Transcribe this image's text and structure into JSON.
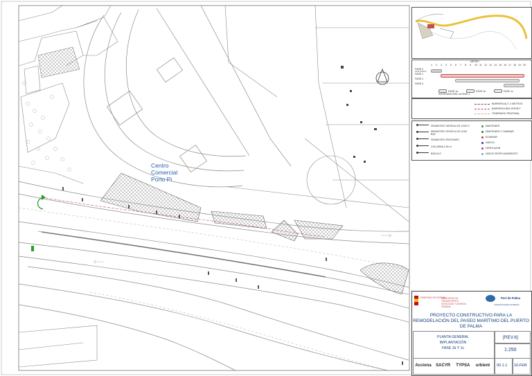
{
  "map": {
    "building_label": "Centro Comercial Porto Pi",
    "north_symbol": "N"
  },
  "timeline": {
    "header": "MESES",
    "months": [
      "1",
      "2",
      "3",
      "4",
      "5",
      "6",
      "7",
      "8",
      "9",
      "10",
      "11",
      "12",
      "13",
      "14",
      "15",
      "16",
      "17",
      "18",
      "19",
      "20"
    ],
    "phases": [
      {
        "label": "FASE 0",
        "sublabel": "FASE PREVIA"
      },
      {
        "label": "FASE 1",
        "sublabel": ""
      },
      {
        "label": "FASE 2",
        "sublabel": ""
      },
      {
        "label": "FASE 3",
        "sublabel": ""
      }
    ],
    "legend": [
      "FASE 1a",
      "FASE 1b",
      "FASE 1c"
    ],
    "legend_note": "INTERVENCIÓN 1a FASE 1"
  },
  "line_legend": {
    "items": [
      {
        "label": "BARRERA ALT. 2 METROS",
        "color": "#555555"
      },
      {
        "label": "BARRERA NEW JERSEY",
        "color": "#c0504d"
      },
      {
        "label": "ITINERARIO PEATONAL",
        "color": "#c9a0a0"
      }
    ]
  },
  "symbol_legend": {
    "left": [
      "SEMAFORO VEHÍCULOS 1/100 V",
      "SEMAFORO VEHÍCULOS 1/100 RAV",
      "SEMAFORO PEATONES",
      "COLUMNA 2.60 m",
      "BÁCULO"
    ],
    "right": [
      {
        "label": "MANTENER",
        "color": "#3a9a3a"
      },
      {
        "label": "MANTENER Y CAMBIAR",
        "color": "#2f7a2f"
      },
      {
        "label": "ELIMINAR",
        "color": "#d03030"
      },
      {
        "label": "NUEVO",
        "color": "#2a3a9a"
      },
      {
        "label": "DESPLAZAR",
        "color": "#b030b0"
      },
      {
        "label": "NUEVO DESPLAZAMIENTO",
        "color": "#60b0d0"
      }
    ]
  },
  "title_block": {
    "ministry_1": "GOBIERNO DE ESPAÑA",
    "ministry_2": "MINISTERIO DE TRANSPORTES, MOVILIDAD Y AGENDA URBANA",
    "port_name": "Port de Palma",
    "port_sub": "Autoritat Portuària de Balears",
    "project_title": "PROYECTO CONSTRUCTIVO PARA LA REMODELACIÓN DEL PASEO MARÍTIMO DEL PUERTO DE PALMA",
    "plan_line1": "PLANTA GENERAL",
    "plan_line2": "IMPLANTACIÓN",
    "plan_line3": "FASE 1b Y 1c",
    "revision": "[REV.6]",
    "scale": "1:250",
    "plan_number": "00.1.1",
    "date": "16-FEB",
    "logos": [
      "Acciona",
      "SACYR",
      "TYPSA",
      "urbient"
    ]
  },
  "colors": {
    "map_lines": "#8a8a8a",
    "hatch": "#9a9a9a",
    "accent_red": "#c0504d",
    "ink_blue": "#123a7a",
    "coast_yellow": "#e8c23a"
  }
}
